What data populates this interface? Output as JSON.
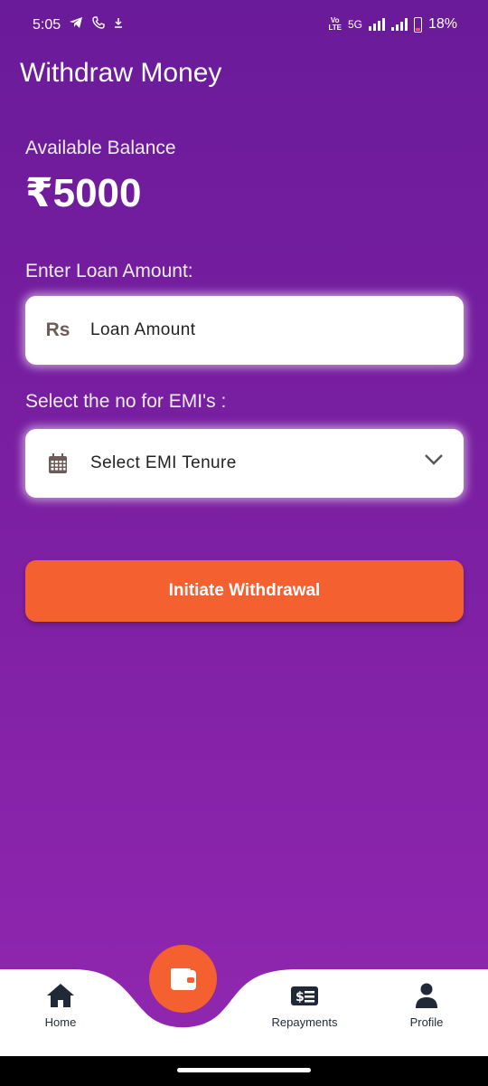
{
  "status_bar": {
    "time": "5:05",
    "network": "5G",
    "volte_line1": "VoLTE",
    "battery": "18%"
  },
  "page": {
    "title": "Withdraw Money"
  },
  "balance": {
    "label": "Available Balance",
    "value": "₹5000"
  },
  "loan_amount": {
    "label": "Enter Loan Amount:",
    "currency_icon_text": "Rs",
    "placeholder": "Loan Amount"
  },
  "emi": {
    "label": "Select the no for EMI's :",
    "placeholder": "Select EMI Tenure"
  },
  "actions": {
    "withdraw_label": "Initiate Withdrawal"
  },
  "bottom_nav": {
    "items": [
      {
        "label": "Home",
        "icon": "home-icon"
      },
      {
        "label": "Repayments",
        "icon": "bill-icon"
      },
      {
        "label": "Profile",
        "icon": "person-icon"
      }
    ],
    "center_icon": "wallet-icon"
  },
  "colors": {
    "bg_top": "#6a1b9a",
    "bg_bottom": "#9227b0",
    "accent": "#f4602f"
  }
}
